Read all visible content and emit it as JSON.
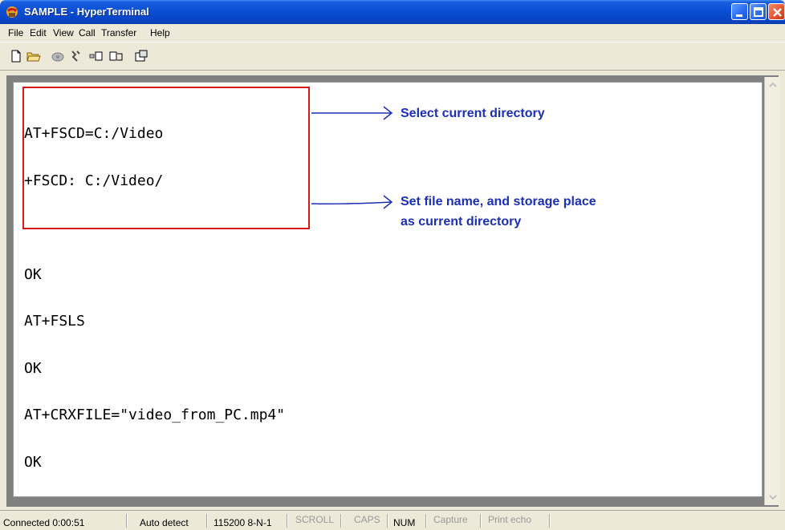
{
  "window": {
    "title": "SAMPLE - HyperTerminal",
    "icons": {
      "app": "hyperterminal-phone-icon",
      "minimize": "minimize-icon",
      "maximize": "maximize-icon",
      "close": "close-icon"
    }
  },
  "menu": [
    "File",
    "Edit",
    "View",
    "Call",
    "Transfer",
    "Help"
  ],
  "toolbar": {
    "icons": [
      "new-document-icon",
      "open-folder-icon",
      "connect-phone-icon",
      "disconnect-icon",
      "send-file-icon",
      "receive-file-icon",
      "properties-icon"
    ]
  },
  "terminal": {
    "lines": [
      "AT+FSCD=C:/Video",
      "+FSCD: C:/Video/",
      "",
      "OK",
      "AT+FSLS",
      "OK",
      "AT+CRXFILE=\"video_from_PC.mp4\"",
      "OK"
    ]
  },
  "annotations": {
    "first": "Select current directory",
    "second_line1": "Set file name, and storage place",
    "second_line2": "as current directory",
    "color": "#1a2fb5",
    "box_color": "#d6181c"
  },
  "statusbar": {
    "connected": "Connected 0:00:51",
    "detect": "Auto detect",
    "settings": "115200 8-N-1",
    "scroll": "SCROLL",
    "caps": "CAPS",
    "num": "NUM",
    "capture": "Capture",
    "print_echo": "Print echo"
  }
}
